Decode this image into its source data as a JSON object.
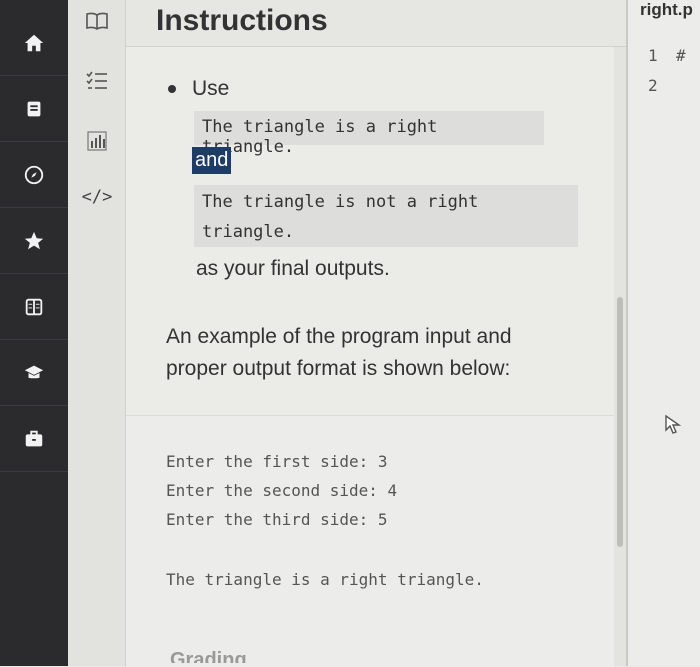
{
  "header": {
    "title": "Instructions"
  },
  "editor": {
    "tab_label": "right.p",
    "lines": [
      {
        "num": "1",
        "code": "#"
      },
      {
        "num": "2",
        "code": ""
      }
    ]
  },
  "tools": {
    "code_icon_text": "</>"
  },
  "content": {
    "use_label": "Use",
    "output_right": "The triangle is a right triangle.",
    "and_label": "and",
    "output_not_right_1": "The triangle is not a right",
    "output_not_right_2": "triangle.",
    "final_outputs": "as your final outputs.",
    "example_intro_1": "An example of the program input and",
    "example_intro_2": "proper output format is shown below:",
    "example": {
      "line1": "Enter the first side: 3",
      "line2": "Enter the second side: 4",
      "line3": "Enter the third side: 5",
      "result": "The triangle is a right triangle."
    },
    "next_heading": "Grading"
  },
  "icons": {
    "nav": [
      "home-icon",
      "book-icon",
      "compass-icon",
      "star-icon",
      "library-icon",
      "graduation-cap-icon",
      "briefcase-icon"
    ],
    "tools": [
      "book-open-icon",
      "checklist-icon",
      "bar-chart-icon",
      "code-icon"
    ]
  }
}
